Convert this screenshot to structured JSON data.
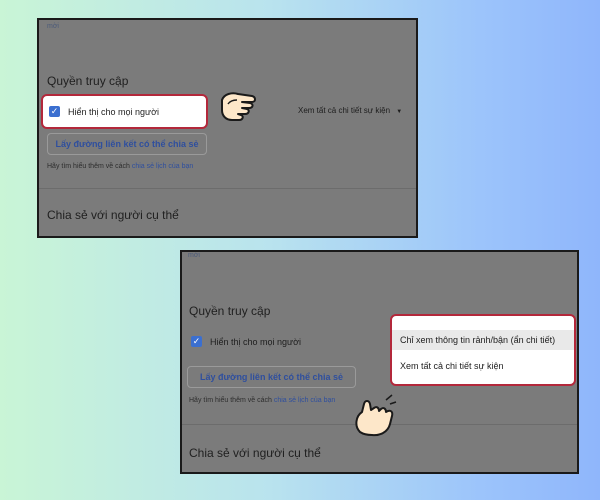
{
  "panel_top": {
    "cropped_text": "mời",
    "section_title": "Quyền truy cập",
    "checkbox_label": "Hiển thị cho mọi người",
    "dropdown_value": "Xem tất cả chi tiết sự kiện",
    "link_button": "Lấy đường liên kết có thể chia sẻ",
    "helper_prefix": "Hãy tìm hiểu thêm về cách",
    "helper_link": "chia sẻ lịch của bạn",
    "share_title": "Chia sẻ với người cụ thể"
  },
  "panel_bottom": {
    "cropped_text": "mời",
    "section_title": "Quyền truy cập",
    "checkbox_label": "Hiển thị cho mọi người",
    "menu_options": [
      "Chỉ xem thông tin rảnh/bận (ẩn chi tiết)",
      "Xem tất cả chi tiết sự kiện"
    ],
    "link_button": "Lấy đường liên kết có thể chia sẻ",
    "helper_prefix": "Hãy tìm hiểu thêm về cách",
    "helper_link": "chia sẻ lịch của bạn",
    "share_title": "Chia sẻ với người cụ thể"
  },
  "colors": {
    "highlight_border": "#b3283b",
    "checkbox": "#3b6fd0",
    "overlay": "#7b7b7b",
    "hand_fill": "#fde7c9"
  },
  "icons": [
    "check-icon",
    "dropdown-arrow-icon",
    "pointing-hand-icon"
  ]
}
